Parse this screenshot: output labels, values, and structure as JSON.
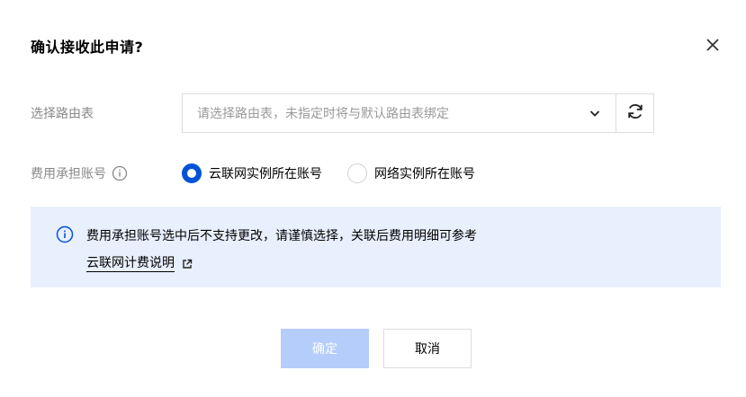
{
  "dialog": {
    "title": "确认接收此申请?",
    "close_icon": "close-icon"
  },
  "route_table": {
    "label": "选择路由表",
    "placeholder": "请选择路由表，未指定时将与默认路由表绑定",
    "chevron_icon": "chevron-down-icon",
    "refresh_icon": "refresh-icon"
  },
  "cost_account": {
    "label": "费用承担账号",
    "info_icon": "info-icon",
    "options": [
      {
        "label": "云联网实例所在账号",
        "selected": true
      },
      {
        "label": "网络实例所在账号",
        "selected": false
      }
    ]
  },
  "notice": {
    "icon": "info-icon",
    "text": "费用承担账号选中后不支持更改，请谨慎选择，关联后费用明细可参考",
    "link_text": "云联网计费说明",
    "link_icon": "external-link-icon"
  },
  "buttons": {
    "ok_label": "确定",
    "cancel_label": "取消"
  },
  "colors": {
    "accent": "#0052d9",
    "notice_bg": "#e8effd",
    "ok_disabled_bg": "#b5cdfb"
  }
}
